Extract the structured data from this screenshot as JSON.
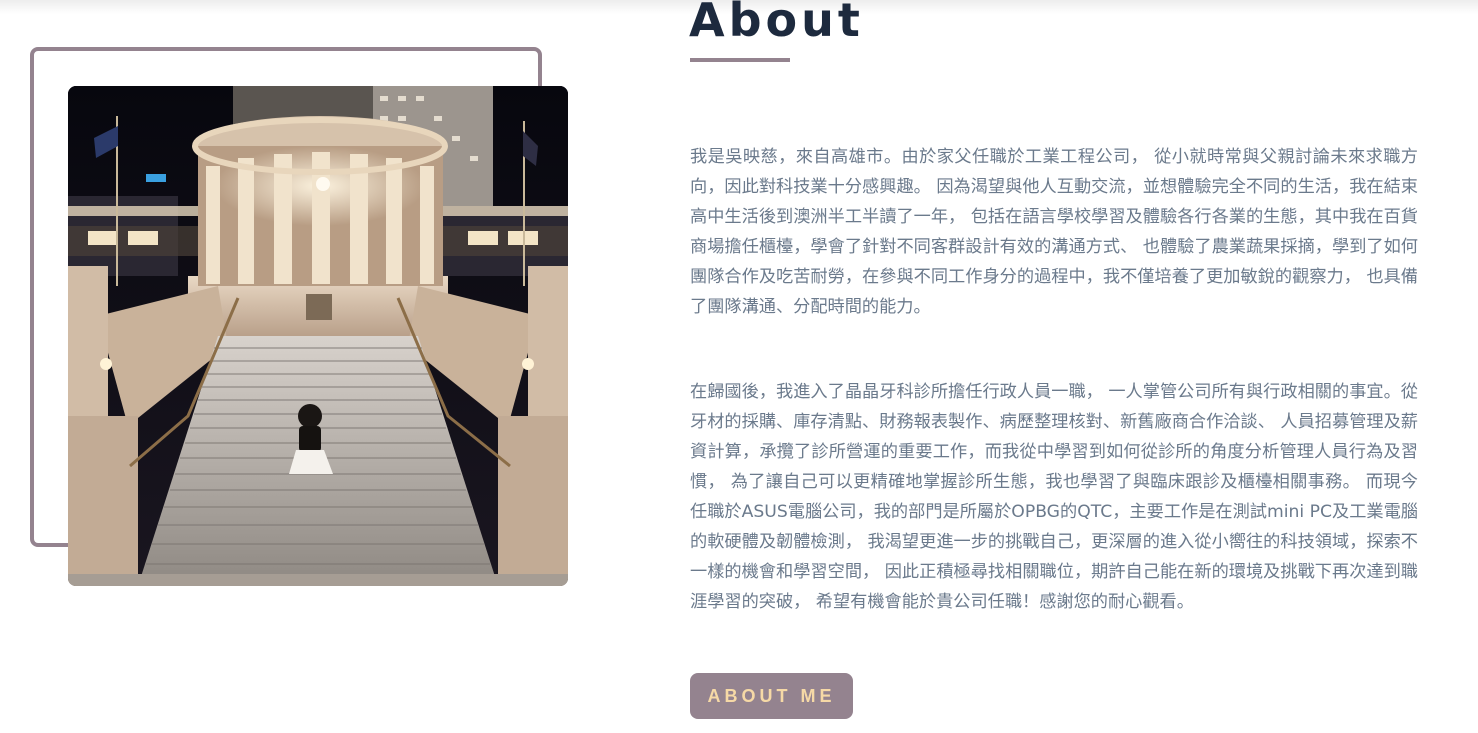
{
  "section": {
    "title": "About"
  },
  "bio": {
    "paragraph_1": "我是吳映慈，來自高雄市。由於家父任職於工業工程公司， 從小就時常與父親討論未來求職方向，因此對科技業十分感興趣。 因為渴望與他人互動交流，並想體驗完全不同的生活，我在結束高中生活後到澳洲半工半讀了一年， 包括在語言學校學習及體驗各行各業的生態，其中我在百貨商場擔任櫃檯，學會了針對不同客群設計有效的溝通方式、 也體驗了農業蔬果採摘，學到了如何團隊合作及吃苦耐勞，在參與不同工作身分的過程中，我不僅培養了更加敏銳的觀察力， 也具備了團隊溝通、分配時間的能力。",
    "paragraph_2": "在歸國後，我進入了晶晶牙科診所擔任行政人員一職， 一人掌管公司所有與行政相關的事宜。從牙材的採購、庫存清點、財務報表製作、病歷整理核對、新舊廠商合作洽談、 人員招募管理及薪資計算，承攬了診所營運的重要工作，而我從中學習到如何從診所的角度分析管理人員行為及習慣， 為了讓自己可以更精確地掌握診所生態，我也學習了與臨床跟診及櫃檯相關事務。 而現今任職於ASUS電腦公司，我的部門是所屬於OPBG的QTC，主要工作是在測試mini PC及工業電腦的軟硬體及韌體檢測， 我渴望更進一步的挑戰自己，更深層的進入從小嚮往的科技領域，探索不一樣的機會和學習空間， 因此正積極尋找相關職位，期許自己能在新的環境及挑戰下再次達到職涯學習的突破， 希望有機會能於貴公司任職！感謝您的耐心觀看。"
  },
  "cta": {
    "label": "ABOUT ME"
  },
  "colors": {
    "accent": "#94838f",
    "title": "#1d2a3e",
    "body_text": "#6b7a8c",
    "button_text": "#f6d9a6"
  }
}
